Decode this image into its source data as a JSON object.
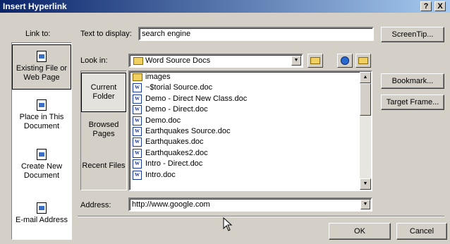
{
  "window": {
    "title": "Insert Hyperlink",
    "help_label": "?",
    "close_label": "X"
  },
  "link_to": {
    "label": "Link to:",
    "items": [
      {
        "label": "Existing File or Web Page",
        "selected": true
      },
      {
        "label": "Place in This Document"
      },
      {
        "label": "Create New Document"
      },
      {
        "label": "E-mail Address"
      }
    ]
  },
  "text_to_display": {
    "label": "Text to display:",
    "value": "search engine"
  },
  "look_in": {
    "label": "Look in:",
    "value": "Word Source Docs"
  },
  "places": [
    {
      "label": "Current Folder",
      "selected": true
    },
    {
      "label": "Browsed Pages"
    },
    {
      "label": "Recent Files"
    }
  ],
  "files": [
    {
      "name": "images",
      "type": "folder"
    },
    {
      "name": "~$torial Source.doc",
      "type": "doc"
    },
    {
      "name": "Demo - Direct New Class.doc",
      "type": "doc"
    },
    {
      "name": "Demo - Direct.doc",
      "type": "doc"
    },
    {
      "name": "Demo.doc",
      "type": "doc"
    },
    {
      "name": "Earthquakes Source.doc",
      "type": "doc"
    },
    {
      "name": "Earthquakes.doc",
      "type": "doc"
    },
    {
      "name": "Earthquakes2.doc",
      "type": "doc"
    },
    {
      "name": "Intro - Direct.doc",
      "type": "doc"
    },
    {
      "name": "Intro.doc",
      "type": "doc"
    }
  ],
  "address": {
    "label": "Address:",
    "value": "http://www.google.com"
  },
  "buttons": {
    "screentip": "ScreenTip...",
    "bookmark": "Bookmark...",
    "target_frame": "Target Frame...",
    "ok": "OK",
    "cancel": "Cancel"
  },
  "colors": {
    "title_start": "#0a246a",
    "title_end": "#a6caf0",
    "face": "#d4d0c8"
  }
}
